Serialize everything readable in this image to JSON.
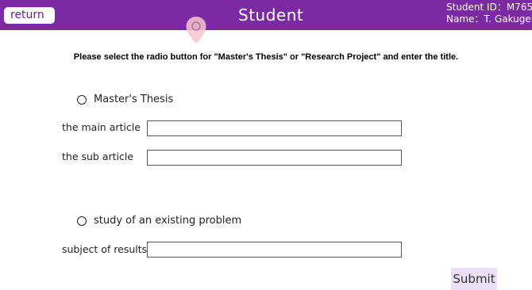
{
  "header": {
    "return_label": "return",
    "title": "Student",
    "student_id": "Student ID：M765",
    "student_name": "Name：T. Gakugei",
    "background_color": "#7b2aa3"
  },
  "instruction": "Please select the radio button for \"Master's Thesis\" or \"Research Project\" and enter the title.",
  "masters": {
    "option_label": "Master's Thesis",
    "main_article_label": "the main article",
    "main_article_value": "",
    "sub_article_label": "the sub article",
    "sub_article_value": ""
  },
  "existing": {
    "option_label": "study of an existing problem",
    "subject_label": "subject of results",
    "subject_value": ""
  },
  "submit_label": "Submit",
  "icons": [
    "location-pin-icon"
  ]
}
